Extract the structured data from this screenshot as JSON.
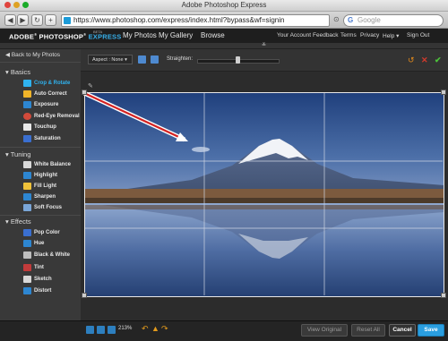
{
  "window": {
    "title": "Adobe Photoshop Express"
  },
  "browser": {
    "url": "https://www.photoshop.com/express/index.html?bypass&wf=signin",
    "search_placeholder": "Google",
    "back_icon": "back-arrow-icon",
    "forward_icon": "forward-arrow-icon",
    "reload_icon": "reload-icon",
    "add_icon": "add-bookmark-icon"
  },
  "app": {
    "brand_adobe": "ADOBE",
    "brand_photoshop": "PHOTOSHOP",
    "brand_express": "EXPRESS",
    "beta": "BETA",
    "nav": [
      "My Photos",
      "My Gallery",
      "Browse"
    ],
    "account_links": [
      "Your Account",
      "Feedback",
      "Terms",
      "Privacy",
      "Help ▾",
      "Sign Out"
    ],
    "accent_color": "#2fb3f0"
  },
  "sidebar": {
    "back_label": "Back to My Photos",
    "sections": [
      {
        "title": "Basics",
        "items": [
          {
            "label": "Crop & Rotate",
            "icon": "crop-icon",
            "active": true
          },
          {
            "label": "Auto Correct",
            "icon": "wand-icon"
          },
          {
            "label": "Exposure",
            "icon": "exposure-icon"
          },
          {
            "label": "Red-Eye Removal",
            "icon": "eye-icon"
          },
          {
            "label": "Touchup",
            "icon": "touchup-icon"
          },
          {
            "label": "Saturation",
            "icon": "saturation-icon"
          }
        ]
      },
      {
        "title": "Tuning",
        "items": [
          {
            "label": "White Balance",
            "icon": "white-balance-icon"
          },
          {
            "label": "Highlight",
            "icon": "highlight-icon"
          },
          {
            "label": "Fill Light",
            "icon": "fill-light-icon"
          },
          {
            "label": "Sharpen",
            "icon": "sharpen-icon"
          },
          {
            "label": "Soft Focus",
            "icon": "soft-focus-icon"
          }
        ]
      },
      {
        "title": "Effects",
        "items": [
          {
            "label": "Pop Color",
            "icon": "pop-color-icon"
          },
          {
            "label": "Hue",
            "icon": "hue-icon"
          },
          {
            "label": "Black & White",
            "icon": "black-white-icon"
          },
          {
            "label": "Tint",
            "icon": "tint-icon"
          },
          {
            "label": "Sketch",
            "icon": "sketch-icon"
          },
          {
            "label": "Distort",
            "icon": "distort-icon"
          }
        ]
      }
    ]
  },
  "edit_toolbar": {
    "aspect_label": "Aspect : None",
    "straighten_label": "Straighten:",
    "straighten_value": 0.5,
    "rotate_icons": [
      "rotate-left-icon",
      "rotate-right-icon"
    ],
    "actions": [
      "reset-icon",
      "cancel-icon",
      "accept-icon"
    ]
  },
  "canvas": {
    "zoom": "213%"
  },
  "footer": {
    "view_original": "View Original",
    "reset_all": "Reset All",
    "cancel": "Cancel",
    "save": "Save"
  }
}
